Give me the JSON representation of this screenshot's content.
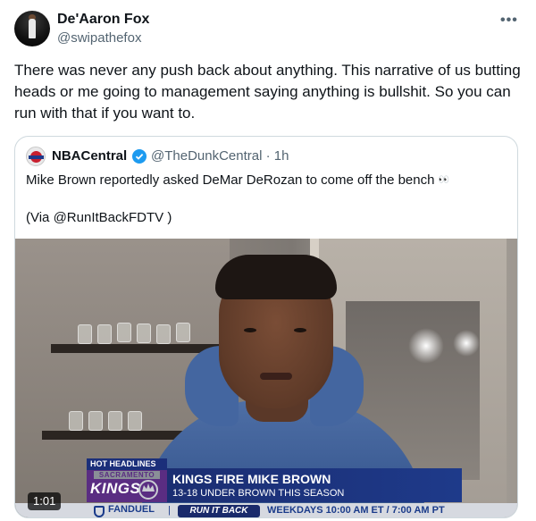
{
  "tweet": {
    "author_name": "De'Aaron Fox",
    "author_handle": "@swipathefox",
    "more_glyph": "•••",
    "text": "There was never any push back about anything. This narrative of us butting heads or me going to management saying anything is bullshit. So you can run with that if you want to."
  },
  "quoted": {
    "author_name": "NBACentral",
    "author_handle": "@TheDunkCentral · 1h",
    "line1": "Mike Brown reportedly asked DeMar DeRozan to come off the bench",
    "line1_emoji": "👀",
    "line2": "(Via @RunItBackFDTV )",
    "verified_color": "#1d9bf0"
  },
  "video": {
    "timestamp": "1:01",
    "graphic": {
      "hot_headlines": "HOT HEADLINES",
      "team_city": "SACRAMENTO",
      "team_name": "KINGS",
      "headline": "KINGS FIRE MIKE BROWN",
      "subhead": "13-18 UNDER BROWN THIS SEASON",
      "sponsor": "FANDUEL",
      "separator": "|",
      "show_name": "RUN IT BACK",
      "schedule": "WEEKDAYS 10:00 AM ET / 7:00 AM PT"
    }
  }
}
